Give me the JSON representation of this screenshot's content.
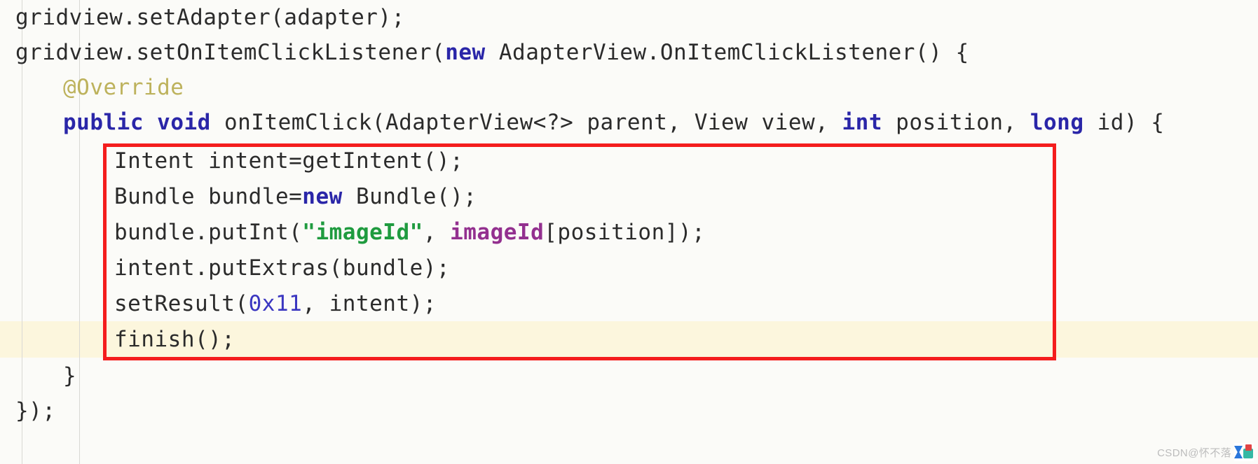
{
  "editor": {
    "background_color": "#fbfbf8",
    "default_text_color": "#2b2b2b",
    "highlight_line_color": "#fcf6dd",
    "annotation_box_color": "#f41d1d",
    "language": "java",
    "lines": [
      {
        "indent": 0,
        "text": "gridview.setAdapter(adapter);"
      },
      {
        "indent": 0,
        "text": "gridview.setOnItemClickListener(new AdapterView.OnItemClickListener() {"
      },
      {
        "indent": 1,
        "text": "@Override"
      },
      {
        "indent": 1,
        "text": "public void onItemClick(AdapterView<?> parent, View view, int position, long id) {"
      },
      {
        "indent": 2,
        "text": "Intent intent=getIntent();"
      },
      {
        "indent": 2,
        "text": "Bundle bundle=new Bundle();"
      },
      {
        "indent": 2,
        "text": "bundle.putInt(\"imageId\", imageId[position]);"
      },
      {
        "indent": 2,
        "text": "intent.putExtras(bundle);"
      },
      {
        "indent": 2,
        "text": "setResult(0x11, intent);"
      },
      {
        "indent": 2,
        "text": "finish();"
      },
      {
        "indent": 1,
        "text": "}"
      },
      {
        "indent": 0,
        "text": "});"
      }
    ],
    "tokens": {
      "keywords": [
        "new",
        "public",
        "void",
        "int",
        "long"
      ],
      "annotation": "@Override",
      "string_literal": "\"imageId\"",
      "highlighted_variable": "imageId",
      "number_literal": "0x11"
    },
    "colors": {
      "keyword": "#2a26a8",
      "annotation": "#bdb25c",
      "string": "#1f9b3f",
      "variable": "#93308f",
      "number": "#3a36c0"
    },
    "highlighted_line_text": "finish();",
    "annotation_box_contains": [
      "Intent intent=getIntent();",
      "Bundle bundle=new Bundle();",
      "bundle.putInt(\"imageId\", imageId[position]);",
      "intent.putExtras(bundle);",
      "setResult(0x11, intent);",
      "finish();"
    ]
  },
  "watermark": {
    "text": "CSDN@怀不落",
    "logo_icon": "csdn-logo-icon"
  }
}
